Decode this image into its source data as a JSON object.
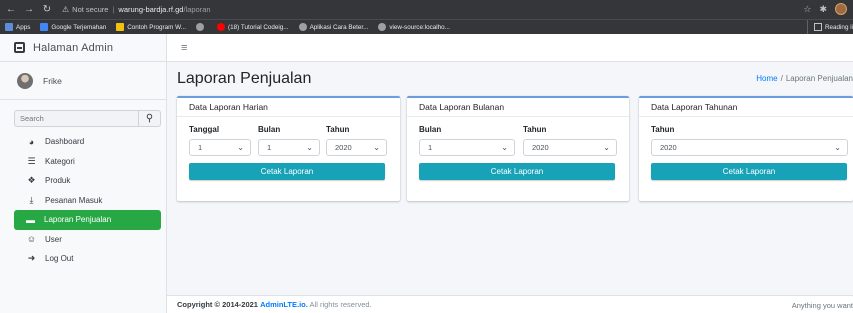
{
  "browser": {
    "not_secure": "Not secure",
    "host": "warung-bardja.rf.gd",
    "path": "/laporan",
    "bookmarks": [
      {
        "label": "Apps",
        "color": "#5c8dd8"
      },
      {
        "label": "Google Terjemahan",
        "color": "#4285f4"
      },
      {
        "label": "Contoh Program W...",
        "color": "#f4c20d"
      },
      {
        "label": "",
        "color": "#9aa0a6"
      },
      {
        "label": "(18) Tutorial Codeig...",
        "color": "#ff0000"
      },
      {
        "label": "Aplikasi Cara Beter...",
        "color": "#9aa0a6"
      },
      {
        "label": "view-source:localho...",
        "color": "#9aa0a6"
      }
    ],
    "reading_list": "Reading li"
  },
  "sidebar": {
    "brand": "Halaman Admin",
    "user": "Frike",
    "search_placeholder": "Search",
    "items": [
      {
        "label": "Dashboard",
        "icon": "tachometer-icon",
        "glyph": "◕"
      },
      {
        "label": "Kategori",
        "icon": "list-icon",
        "glyph": "☰"
      },
      {
        "label": "Produk",
        "icon": "cubes-icon",
        "glyph": "❖"
      },
      {
        "label": "Pesanan Masuk",
        "icon": "download-icon",
        "glyph": "⤓"
      },
      {
        "label": "Laporan Penjualan",
        "icon": "report-icon",
        "glyph": "▬"
      },
      {
        "label": "User",
        "icon": "users-icon",
        "glyph": "☺"
      },
      {
        "label": "Log Out",
        "icon": "sign-out-icon",
        "glyph": "➜"
      }
    ],
    "active_color": "#28a745"
  },
  "header": {
    "page_title": "Laporan Penjualan",
    "breadcrumb_home": "Home",
    "breadcrumb_sep": "/",
    "breadcrumb_current": "Laporan Penjualan"
  },
  "cards": {
    "harian": {
      "title": "Data Laporan Harian",
      "tanggal_label": "Tanggal",
      "tanggal_value": "1",
      "bulan_label": "Bulan",
      "bulan_value": "1",
      "tahun_label": "Tahun",
      "tahun_value": "2020",
      "button": "Cetak Laporan"
    },
    "bulanan": {
      "title": "Data Laporan Bulanan",
      "bulan_label": "Bulan",
      "bulan_value": "1",
      "tahun_label": "Tahun",
      "tahun_value": "2020",
      "button": "Cetak Laporan"
    },
    "tahunan": {
      "title": "Data Laporan Tahunan",
      "tahun_label": "Tahun",
      "tahun_value": "2020",
      "button": "Cetak Laporan"
    }
  },
  "footer": {
    "copyright": "Copyright © 2014-2021",
    "link": "AdminLTE.io.",
    "rights": "All rights reserved.",
    "right_text": "Anything you want"
  }
}
